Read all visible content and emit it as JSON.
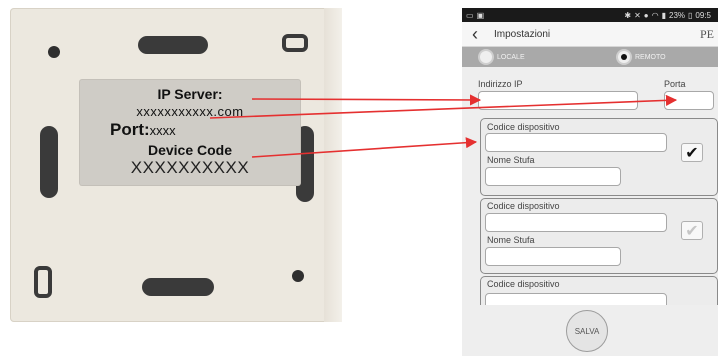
{
  "device_label": {
    "ip_server_heading": "IP Server:",
    "ip_server_value": "xxxxxxxxxxx.com",
    "port_heading": "Port:",
    "port_value": "xxxx",
    "device_code_heading": "Device Code",
    "device_code_value": "XXXXXXXXXX"
  },
  "status_bar": {
    "left_icons": [
      "image-icon",
      "gallery-icon"
    ],
    "right_text": "23%",
    "time": "09:5"
  },
  "nav": {
    "back_icon": "chevron-left-icon",
    "title": "Impostazioni",
    "brand": "PE"
  },
  "mode": {
    "options": [
      "LOCALE",
      "REMOTO"
    ],
    "selected": "REMOTO"
  },
  "connection": {
    "ip_label": "Indirizzo IP",
    "ip_value": "",
    "port_label": "Porta",
    "port_value": ""
  },
  "devices": [
    {
      "code_label": "Codice dispositivo",
      "code_value": "",
      "name_label": "Nome Stufa",
      "name_value": "",
      "checked": true
    },
    {
      "code_label": "Codice dispositivo",
      "code_value": "",
      "name_label": "Nome Stufa",
      "name_value": "",
      "checked": false
    },
    {
      "code_label": "Codice dispositivo",
      "code_value": "",
      "name_label": "",
      "name_value": "",
      "checked": false
    }
  ],
  "save_label": "SALVA",
  "colors": {
    "arrow": "#e53030",
    "segment_bg": "#a9a9a9",
    "device_plate": "#ece8df"
  }
}
